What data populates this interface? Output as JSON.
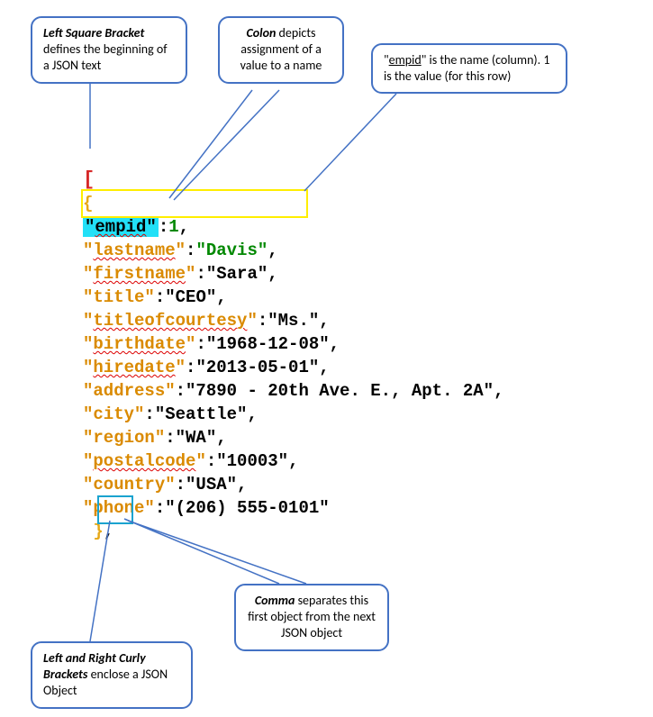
{
  "callouts": {
    "left_bracket": {
      "text_prefix": "Left Square Bracket",
      "text_rest": " defines the beginning of a JSON text"
    },
    "colon": {
      "text_prefix": "Colon",
      "text_rest": " depicts assignment of a value to a name"
    },
    "empid": {
      "text": "\"empid\" is the name (column). 1 is the value (for this row)"
    },
    "curly": {
      "text_prefix": "Left and Right Curly Brackets",
      "text_rest": " enclose a JSON Object"
    },
    "comma": {
      "text_prefix": "Comma",
      "text_rest": " separates this first object from the next JSON object"
    }
  },
  "json_code": {
    "open_bracket": "[",
    "open_brace": "{",
    "fields": [
      {
        "key": "empid",
        "value": "1",
        "is_number": true,
        "highlight": true
      },
      {
        "key": "lastname",
        "value": "Davis",
        "value_green": true
      },
      {
        "key": "firstname",
        "value": "Sara"
      },
      {
        "key": "title",
        "value": "CEO"
      },
      {
        "key": "titleofcourtesy",
        "value": "Ms."
      },
      {
        "key": "birthdate",
        "value": "1968-12-08"
      },
      {
        "key": "hiredate",
        "value": "2013-05-01"
      },
      {
        "key": "address",
        "value": "7890 - 20th Ave. E., Apt. 2A"
      },
      {
        "key": "city",
        "value": "Seattle"
      },
      {
        "key": "region",
        "value": "WA"
      },
      {
        "key": "postalcode",
        "value": "10003"
      },
      {
        "key": "country",
        "value": "USA"
      },
      {
        "key": "phone",
        "value": "(206) 555-0101",
        "last": true
      }
    ],
    "close_brace": "}",
    "trailing_comma": ","
  }
}
